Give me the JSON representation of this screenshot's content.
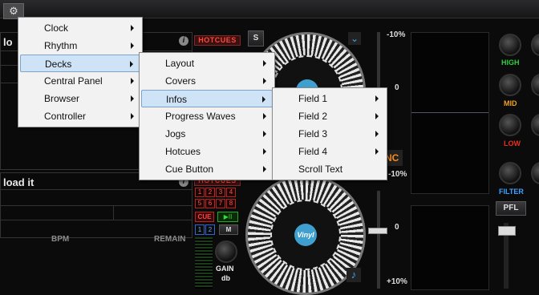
{
  "app": {
    "settings_icon_glyph": "⚙",
    "deck1_title": "lo",
    "deck2_title": "load it",
    "hotcues_label": "HOTCUES",
    "info_glyph": "i",
    "bpm_label": "BPM",
    "remain_label": "REMAIN",
    "sync_label": "NC",
    "pct_plus10": "-10%",
    "pct_zero": "0",
    "pct_minus10": "-10%",
    "pct_zero2": "0",
    "pct_plus10b": "+10%",
    "cue_label": "CUE",
    "gain_label": "GAIN",
    "db_label": "db",
    "eq": {
      "high": "HIGH",
      "mid": "MID",
      "low": "LOW",
      "filter": "FILTER"
    },
    "pfl_label": "PFL",
    "jog_brand": "Vinyl",
    "hotcue_nums": [
      "1",
      "2",
      "3",
      "4",
      "5",
      "6",
      "7",
      "8"
    ],
    "loop_nums": [
      "1",
      "2"
    ],
    "m_label": "M",
    "s_label": "S",
    "colors": {
      "high": "#2ecc40",
      "mid": "#f0a020",
      "low": "#e83020",
      "filter": "#3fa0ff",
      "sync": "#ff8c1a"
    }
  },
  "menu_level1": {
    "items": [
      {
        "label": "Clock"
      },
      {
        "label": "Rhythm"
      },
      {
        "label": "Decks"
      },
      {
        "label": "Central Panel"
      },
      {
        "label": "Browser"
      },
      {
        "label": "Controller"
      }
    ],
    "selected": "Decks"
  },
  "menu_level2": {
    "items": [
      {
        "label": "Layout"
      },
      {
        "label": "Covers"
      },
      {
        "label": "Infos"
      },
      {
        "label": "Progress Waves"
      },
      {
        "label": "Jogs"
      },
      {
        "label": "Hotcues"
      },
      {
        "label": "Cue Button"
      }
    ],
    "selected": "Infos"
  },
  "menu_level3": {
    "items": [
      {
        "label": "Field 1"
      },
      {
        "label": "Field 2"
      },
      {
        "label": "Field 3"
      },
      {
        "label": "Field 4"
      },
      {
        "label": "Scroll Text"
      }
    ]
  }
}
